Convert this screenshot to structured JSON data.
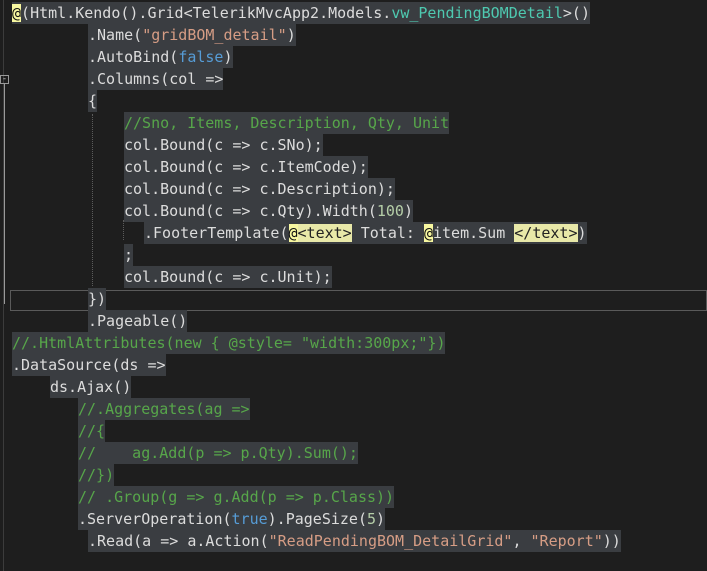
{
  "editor": {
    "fold_glyph": "-",
    "lines": [
      [
        {
          "t": "@",
          "c": "razor"
        },
        {
          "t": "(",
          "c": "plain"
        },
        {
          "t": "Html",
          "c": "plain"
        },
        {
          "t": ".Kendo().Grid<",
          "c": "plain"
        },
        {
          "t": "TelerikMvcApp2",
          "c": "plain"
        },
        {
          "t": ".Models.",
          "c": "plain"
        },
        {
          "t": "vw_PendingBOMDetail",
          "c": "type"
        },
        {
          "t": ">()",
          "c": "plain"
        }
      ],
      [
        {
          "t": ".Name(",
          "c": "plain"
        },
        {
          "t": "\"gridBOM_detail\"",
          "c": "str"
        },
        {
          "t": ")",
          "c": "plain"
        }
      ],
      [
        {
          "t": ".AutoBind(",
          "c": "plain"
        },
        {
          "t": "false",
          "c": "kw"
        },
        {
          "t": ")",
          "c": "plain"
        }
      ],
      [
        {
          "t": ".Columns(",
          "c": "plain"
        },
        {
          "t": "col",
          "c": "plain"
        },
        {
          "t": " =>",
          "c": "plain"
        }
      ],
      [
        {
          "t": "{",
          "c": "plain"
        }
      ],
      [
        {
          "t": "//Sno, Items, Description, Qty, Unit",
          "c": "com"
        }
      ],
      [
        {
          "t": "col.Bound(c => c.SNo);",
          "c": "plain"
        }
      ],
      [
        {
          "t": "col.Bound(c => c.ItemCode);",
          "c": "plain"
        }
      ],
      [
        {
          "t": "col.Bound(c => c.Description);",
          "c": "plain"
        }
      ],
      [
        {
          "t": "col.Bound(c => c.Qty).Width(",
          "c": "plain"
        },
        {
          "t": "100",
          "c": "num"
        },
        {
          "t": ")",
          "c": "plain"
        }
      ],
      [
        {
          "t": ".FooterTemplate(",
          "c": "plain"
        },
        {
          "t": "@",
          "c": "razor"
        },
        {
          "t": "<text>",
          "c": "tag"
        },
        {
          "t": " Total: ",
          "c": "plain"
        },
        {
          "t": "@",
          "c": "razor"
        },
        {
          "t": "item.Sum ",
          "c": "plain"
        },
        {
          "t": "</text>",
          "c": "tag"
        },
        {
          "t": ")",
          "c": "plain"
        }
      ],
      [
        {
          "t": ";",
          "c": "plain"
        }
      ],
      [
        {
          "t": "col.Bound(c => c.Unit);",
          "c": "plain"
        }
      ],
      [
        {
          "t": "})",
          "c": "plain"
        }
      ],
      [
        {
          "t": ".Pageable()",
          "c": "plain"
        }
      ],
      [
        {
          "t": "//.HtmlAttributes(new { @style= \"width:300px;\"})",
          "c": "com"
        }
      ],
      [
        {
          "t": ".DataSource(ds =>",
          "c": "plain"
        }
      ],
      [
        {
          "t": "ds.Ajax()",
          "c": "plain"
        }
      ],
      [
        {
          "t": "//.Aggregates(ag =>",
          "c": "com"
        }
      ],
      [
        {
          "t": "//{",
          "c": "com"
        }
      ],
      [
        {
          "t": "//    ag.Add(p => p.Qty).Sum();",
          "c": "com"
        }
      ],
      [
        {
          "t": "//})",
          "c": "com"
        }
      ],
      [
        {
          "t": "// .Group(g => g.Add(p => p.Class))",
          "c": "com"
        }
      ],
      [
        {
          "t": ".ServerOperation(",
          "c": "plain"
        },
        {
          "t": "true",
          "c": "kw"
        },
        {
          "t": ").PageSize(",
          "c": "plain"
        },
        {
          "t": "5",
          "c": "num"
        },
        {
          "t": ")",
          "c": "plain"
        }
      ],
      [
        {
          "t": ".Read(a => a.Action(",
          "c": "plain"
        },
        {
          "t": "\"ReadPendingBOM_DetailGrid\"",
          "c": "str"
        },
        {
          "t": ", ",
          "c": "plain"
        },
        {
          "t": "\"Report\"",
          "c": "str"
        },
        {
          "t": "))",
          "c": "plain"
        }
      ]
    ]
  }
}
